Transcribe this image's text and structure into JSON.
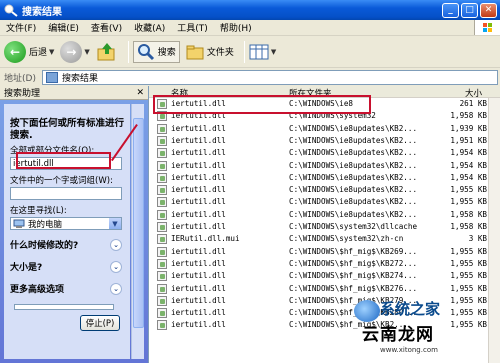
{
  "window": {
    "title": "搜索结果"
  },
  "menu": [
    "文件(F)",
    "编辑(E)",
    "查看(V)",
    "收藏(A)",
    "工具(T)",
    "帮助(H)"
  ],
  "toolbar": {
    "back_label": "后退",
    "search_label": "搜索",
    "folders_label": "文件夹"
  },
  "address": {
    "label": "地址(D)",
    "value": "搜索结果"
  },
  "left_pane": {
    "title": "搜索助理",
    "heading": "按下面任何或所有标准进行搜索.",
    "name_label": "全部或部分文件名(O):",
    "name_value": "iertutil.dll",
    "word_label": "文件中的一个字或词组(W):",
    "word_value": "",
    "lookin_label": "在这里寻找(L):",
    "lookin_value": "我的电脑",
    "option_modified": "什么时候修改的?",
    "option_size": "大小是?",
    "option_advanced": "更多高级选项",
    "stop_button": "停止(P)"
  },
  "columns": {
    "name": "名称",
    "folder": "所在文件夹",
    "size": "大小"
  },
  "files": [
    {
      "name": "iertutil.dll",
      "folder": "C:\\WINDOWS\\ie8",
      "size": "261 KB",
      "ext": "D"
    },
    {
      "name": "iertutil.dll",
      "folder": "C:\\WINDOWS\\system32",
      "size": "1,958 KB",
      "ext": "B"
    },
    {
      "name": "iertutil.dll",
      "folder": "C:\\WINDOWS\\ie8updates\\KB2...",
      "size": "1,939 KB",
      "ext": "B"
    },
    {
      "name": "iertutil.dll",
      "folder": "C:\\WINDOWS\\ie8updates\\KB2...",
      "size": "1,951 KB",
      "ext": "B"
    },
    {
      "name": "iertutil.dll",
      "folder": "C:\\WINDOWS\\ie8updates\\KB2...",
      "size": "1,954 KB",
      "ext": "B"
    },
    {
      "name": "iertutil.dll",
      "folder": "C:\\WINDOWS\\ie8updates\\KB2...",
      "size": "1,954 KB",
      "ext": "B"
    },
    {
      "name": "iertutil.dll",
      "folder": "C:\\WINDOWS\\ie8updates\\KB2...",
      "size": "1,954 KB",
      "ext": "B"
    },
    {
      "name": "iertutil.dll",
      "folder": "C:\\WINDOWS\\ie8updates\\KB2...",
      "size": "1,955 KB",
      "ext": "B"
    },
    {
      "name": "iertutil.dll",
      "folder": "C:\\WINDOWS\\ie8updates\\KB2...",
      "size": "1,955 KB",
      "ext": "B"
    },
    {
      "name": "iertutil.dll",
      "folder": "C:\\WINDOWS\\ie8updates\\KB2...",
      "size": "1,958 KB",
      "ext": "B"
    },
    {
      "name": "iertutil.dll",
      "folder": "C:\\WINDOWS\\system32\\dllcache",
      "size": "1,958 KB",
      "ext": "B"
    },
    {
      "name": "IERutil.dll.mui",
      "folder": "C:\\WINDOWS\\system32\\zh-cn",
      "size": "3 KB",
      "ext": "M"
    },
    {
      "name": "iertutil.dll",
      "folder": "C:\\WINDOWS\\$hf_mig$\\KB269...",
      "size": "1,955 KB",
      "ext": "B"
    },
    {
      "name": "iertutil.dll",
      "folder": "C:\\WINDOWS\\$hf_mig$\\KB272...",
      "size": "1,955 KB",
      "ext": "B"
    },
    {
      "name": "iertutil.dll",
      "folder": "C:\\WINDOWS\\$hf_mig$\\KB274...",
      "size": "1,955 KB",
      "ext": "B"
    },
    {
      "name": "iertutil.dll",
      "folder": "C:\\WINDOWS\\$hf_mig$\\KB276...",
      "size": "1,955 KB",
      "ext": "B"
    },
    {
      "name": "iertutil.dll",
      "folder": "C:\\WINDOWS\\$hf_mig$\\KB279...",
      "size": "1,955 KB",
      "ext": "B"
    },
    {
      "name": "iertutil.dll",
      "folder": "C:\\WINDOWS\\$hf_mig$\\KB280...",
      "size": "1,955 KB",
      "ext": "B"
    },
    {
      "name": "iertutil.dll",
      "folder": "C:\\WINDOWS\\$hf_mig$\\KB2...",
      "size": "1,955 KB",
      "ext": "B"
    }
  ],
  "watermark": {
    "line1": "系统之家",
    "line2": "云南龙网",
    "line3": "www.xitong.com"
  }
}
